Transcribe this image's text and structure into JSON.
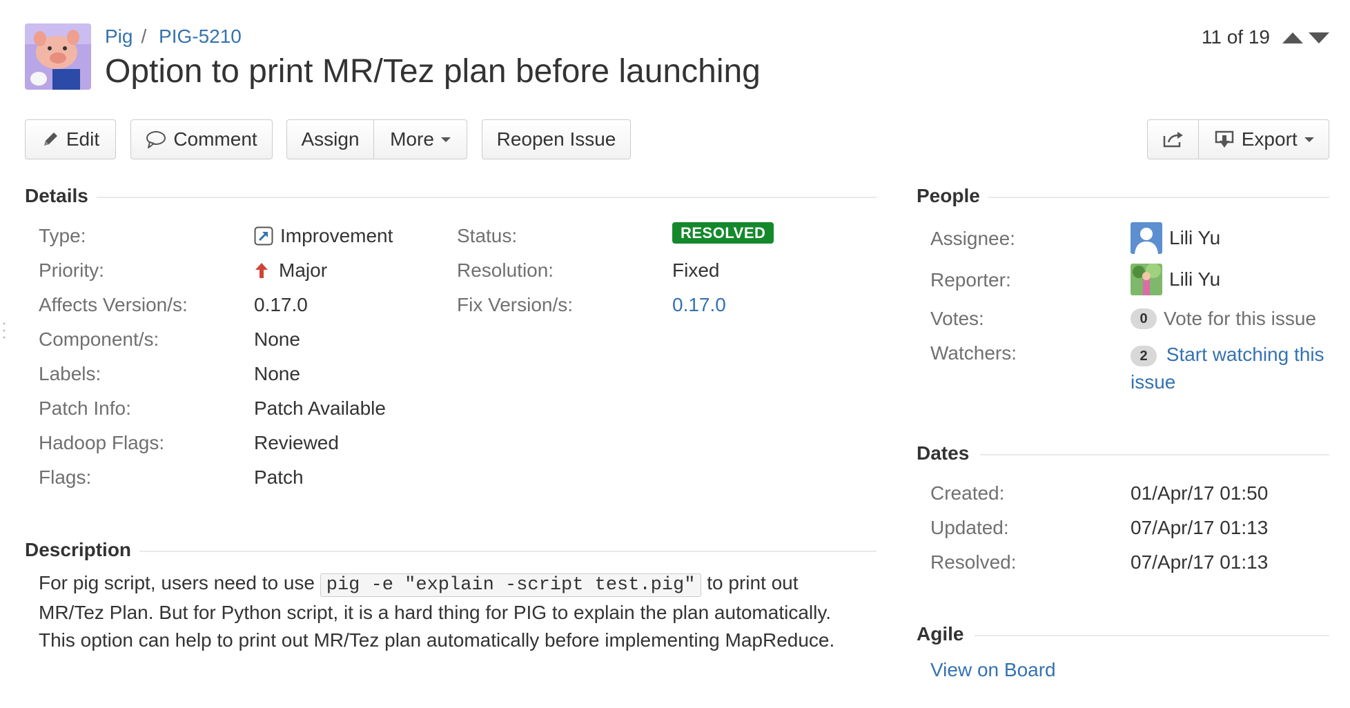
{
  "breadcrumb": {
    "project": "Pig",
    "issue_key": "PIG-5210"
  },
  "issue": {
    "title": "Option to print MR/Tez plan before launching"
  },
  "pager": {
    "text": "11 of 19"
  },
  "toolbar": {
    "edit": "Edit",
    "comment": "Comment",
    "assign": "Assign",
    "more": "More",
    "reopen": "Reopen Issue",
    "export": "Export"
  },
  "details": {
    "heading": "Details",
    "rows_left": [
      {
        "label": "Type:",
        "value": "Improvement"
      },
      {
        "label": "Priority:",
        "value": "Major"
      },
      {
        "label": "Affects Version/s:",
        "value": "0.17.0"
      },
      {
        "label": "Component/s:",
        "value": "None"
      },
      {
        "label": "Labels:",
        "value": "None"
      },
      {
        "label": "Patch Info:",
        "value": "Patch Available"
      },
      {
        "label": "Hadoop Flags:",
        "value": "Reviewed"
      },
      {
        "label": "Flags:",
        "value": "Patch"
      }
    ],
    "rows_right": [
      {
        "label": "Status:",
        "value": "RESOLVED"
      },
      {
        "label": "Resolution:",
        "value": "Fixed"
      },
      {
        "label": "Fix Version/s:",
        "value": "0.17.0"
      }
    ]
  },
  "description": {
    "heading": "Description",
    "text_before": "For pig script, users need to use",
    "code": "pig -e \"explain -script test.pig\"",
    "text_after": "to print out MR/Tez Plan. But for Python script, it is a hard thing for PIG to explain the plan automatically. This option can help to print out MR/Tez plan automatically before implementing MapReduce."
  },
  "people": {
    "heading": "People",
    "assignee_label": "Assignee:",
    "assignee": "Lili Yu",
    "reporter_label": "Reporter:",
    "reporter": "Lili Yu",
    "votes_label": "Votes:",
    "votes_count": "0",
    "votes_text": "Vote for this issue",
    "watchers_label": "Watchers:",
    "watchers_count": "2",
    "watch_link": "Start watching this issue"
  },
  "dates": {
    "heading": "Dates",
    "created_label": "Created:",
    "created": "01/Apr/17 01:50",
    "updated_label": "Updated:",
    "updated": "07/Apr/17 01:13",
    "resolved_label": "Resolved:",
    "resolved": "07/Apr/17 01:13"
  },
  "agile": {
    "heading": "Agile",
    "link": "View on Board"
  },
  "colors": {
    "link": "#3572b0",
    "resolved": "#14892c",
    "priority_major": "#d04437"
  },
  "icons": [
    "pencil-icon",
    "comment-icon",
    "share-icon",
    "export-icon",
    "improvement-type-icon",
    "priority-major-icon",
    "arrow-up-icon",
    "arrow-down-icon"
  ]
}
